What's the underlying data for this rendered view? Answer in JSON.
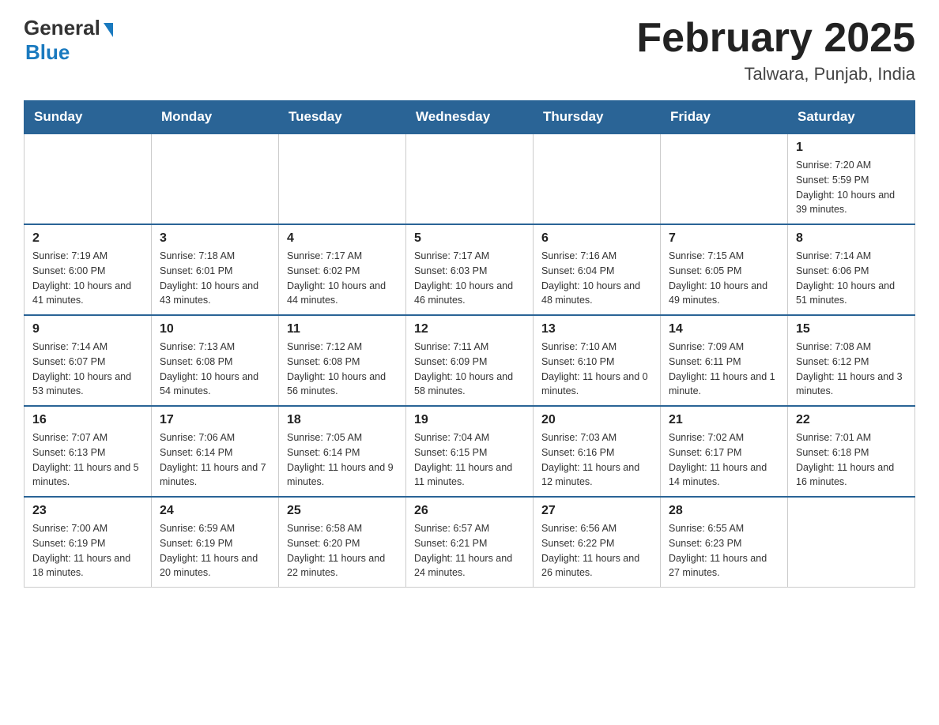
{
  "header": {
    "logo_general": "General",
    "logo_blue": "Blue",
    "month_title": "February 2025",
    "location": "Talwara, Punjab, India"
  },
  "days_of_week": [
    "Sunday",
    "Monday",
    "Tuesday",
    "Wednesday",
    "Thursday",
    "Friday",
    "Saturday"
  ],
  "weeks": [
    {
      "days": [
        {
          "num": "",
          "info": ""
        },
        {
          "num": "",
          "info": ""
        },
        {
          "num": "",
          "info": ""
        },
        {
          "num": "",
          "info": ""
        },
        {
          "num": "",
          "info": ""
        },
        {
          "num": "",
          "info": ""
        },
        {
          "num": "1",
          "info": "Sunrise: 7:20 AM\nSunset: 5:59 PM\nDaylight: 10 hours and 39 minutes."
        }
      ]
    },
    {
      "days": [
        {
          "num": "2",
          "info": "Sunrise: 7:19 AM\nSunset: 6:00 PM\nDaylight: 10 hours and 41 minutes."
        },
        {
          "num": "3",
          "info": "Sunrise: 7:18 AM\nSunset: 6:01 PM\nDaylight: 10 hours and 43 minutes."
        },
        {
          "num": "4",
          "info": "Sunrise: 7:17 AM\nSunset: 6:02 PM\nDaylight: 10 hours and 44 minutes."
        },
        {
          "num": "5",
          "info": "Sunrise: 7:17 AM\nSunset: 6:03 PM\nDaylight: 10 hours and 46 minutes."
        },
        {
          "num": "6",
          "info": "Sunrise: 7:16 AM\nSunset: 6:04 PM\nDaylight: 10 hours and 48 minutes."
        },
        {
          "num": "7",
          "info": "Sunrise: 7:15 AM\nSunset: 6:05 PM\nDaylight: 10 hours and 49 minutes."
        },
        {
          "num": "8",
          "info": "Sunrise: 7:14 AM\nSunset: 6:06 PM\nDaylight: 10 hours and 51 minutes."
        }
      ]
    },
    {
      "days": [
        {
          "num": "9",
          "info": "Sunrise: 7:14 AM\nSunset: 6:07 PM\nDaylight: 10 hours and 53 minutes."
        },
        {
          "num": "10",
          "info": "Sunrise: 7:13 AM\nSunset: 6:08 PM\nDaylight: 10 hours and 54 minutes."
        },
        {
          "num": "11",
          "info": "Sunrise: 7:12 AM\nSunset: 6:08 PM\nDaylight: 10 hours and 56 minutes."
        },
        {
          "num": "12",
          "info": "Sunrise: 7:11 AM\nSunset: 6:09 PM\nDaylight: 10 hours and 58 minutes."
        },
        {
          "num": "13",
          "info": "Sunrise: 7:10 AM\nSunset: 6:10 PM\nDaylight: 11 hours and 0 minutes."
        },
        {
          "num": "14",
          "info": "Sunrise: 7:09 AM\nSunset: 6:11 PM\nDaylight: 11 hours and 1 minute."
        },
        {
          "num": "15",
          "info": "Sunrise: 7:08 AM\nSunset: 6:12 PM\nDaylight: 11 hours and 3 minutes."
        }
      ]
    },
    {
      "days": [
        {
          "num": "16",
          "info": "Sunrise: 7:07 AM\nSunset: 6:13 PM\nDaylight: 11 hours and 5 minutes."
        },
        {
          "num": "17",
          "info": "Sunrise: 7:06 AM\nSunset: 6:14 PM\nDaylight: 11 hours and 7 minutes."
        },
        {
          "num": "18",
          "info": "Sunrise: 7:05 AM\nSunset: 6:14 PM\nDaylight: 11 hours and 9 minutes."
        },
        {
          "num": "19",
          "info": "Sunrise: 7:04 AM\nSunset: 6:15 PM\nDaylight: 11 hours and 11 minutes."
        },
        {
          "num": "20",
          "info": "Sunrise: 7:03 AM\nSunset: 6:16 PM\nDaylight: 11 hours and 12 minutes."
        },
        {
          "num": "21",
          "info": "Sunrise: 7:02 AM\nSunset: 6:17 PM\nDaylight: 11 hours and 14 minutes."
        },
        {
          "num": "22",
          "info": "Sunrise: 7:01 AM\nSunset: 6:18 PM\nDaylight: 11 hours and 16 minutes."
        }
      ]
    },
    {
      "days": [
        {
          "num": "23",
          "info": "Sunrise: 7:00 AM\nSunset: 6:19 PM\nDaylight: 11 hours and 18 minutes."
        },
        {
          "num": "24",
          "info": "Sunrise: 6:59 AM\nSunset: 6:19 PM\nDaylight: 11 hours and 20 minutes."
        },
        {
          "num": "25",
          "info": "Sunrise: 6:58 AM\nSunset: 6:20 PM\nDaylight: 11 hours and 22 minutes."
        },
        {
          "num": "26",
          "info": "Sunrise: 6:57 AM\nSunset: 6:21 PM\nDaylight: 11 hours and 24 minutes."
        },
        {
          "num": "27",
          "info": "Sunrise: 6:56 AM\nSunset: 6:22 PM\nDaylight: 11 hours and 26 minutes."
        },
        {
          "num": "28",
          "info": "Sunrise: 6:55 AM\nSunset: 6:23 PM\nDaylight: 11 hours and 27 minutes."
        },
        {
          "num": "",
          "info": ""
        }
      ]
    }
  ]
}
